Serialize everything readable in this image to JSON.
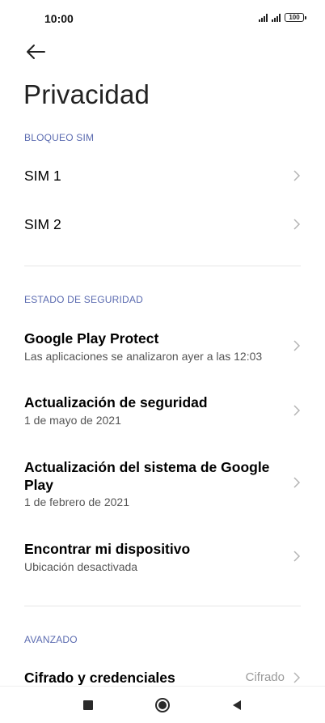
{
  "status_bar": {
    "time": "10:00",
    "battery": "100"
  },
  "header": {
    "title": "Privacidad"
  },
  "sections": {
    "sim": {
      "label": "BLOQUEO SIM",
      "items": [
        {
          "title": "SIM 1"
        },
        {
          "title": "SIM 2"
        }
      ]
    },
    "security": {
      "label": "ESTADO DE SEGURIDAD",
      "items": [
        {
          "title": "Google Play Protect",
          "subtitle": "Las aplicaciones se analizaron ayer a las 12:03"
        },
        {
          "title": "Actualización de seguridad",
          "subtitle": "1 de mayo de 2021"
        },
        {
          "title": "Actualización del sistema de Google Play",
          "subtitle": "1 de febrero de 2021"
        },
        {
          "title": "Encontrar mi dispositivo",
          "subtitle": "Ubicación desactivada"
        }
      ]
    },
    "advanced": {
      "label": "AVANZADO",
      "items": [
        {
          "title": "Cifrado y credenciales",
          "value": "Cifrado"
        }
      ]
    }
  },
  "icons": {
    "back": "arrow-left-icon",
    "chevron": "chevron-right-icon",
    "nav_recent": "square-icon",
    "nav_home": "circle-icon",
    "nav_back": "triangle-left-icon"
  },
  "colors": {
    "section_header": "#5b6bb0",
    "subtitle": "#555555",
    "chevron": "#b5b5b5"
  }
}
